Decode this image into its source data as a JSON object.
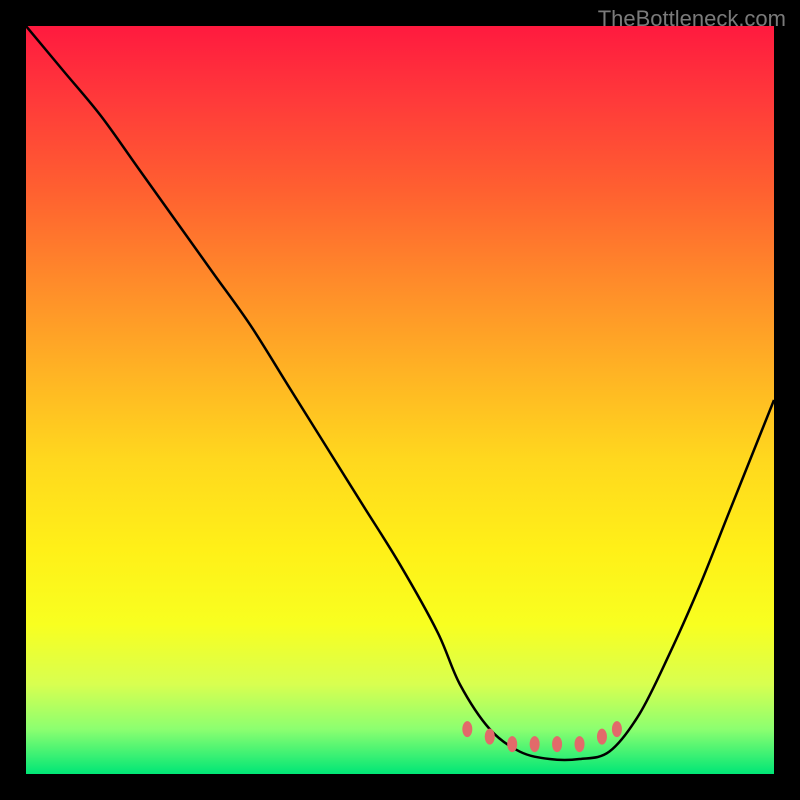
{
  "watermark": "TheBottleneck.com",
  "chart_data": {
    "type": "line",
    "title": "",
    "xlabel": "",
    "ylabel": "",
    "xlim": [
      0,
      100
    ],
    "ylim": [
      0,
      100
    ],
    "grid": false,
    "background_gradient": {
      "direction": "vertical",
      "stops": [
        {
          "pos": 0.0,
          "color": "#ff1a3f"
        },
        {
          "pos": 0.1,
          "color": "#ff3a3a"
        },
        {
          "pos": 0.22,
          "color": "#ff6030"
        },
        {
          "pos": 0.34,
          "color": "#ff8a2a"
        },
        {
          "pos": 0.46,
          "color": "#ffb224"
        },
        {
          "pos": 0.58,
          "color": "#ffd81e"
        },
        {
          "pos": 0.7,
          "color": "#fff018"
        },
        {
          "pos": 0.8,
          "color": "#f8ff20"
        },
        {
          "pos": 0.88,
          "color": "#d8ff50"
        },
        {
          "pos": 0.94,
          "color": "#8cff70"
        },
        {
          "pos": 1.0,
          "color": "#00e676"
        }
      ]
    },
    "series": [
      {
        "name": "bottleneck-curve",
        "color": "#000000",
        "x": [
          0,
          5,
          10,
          15,
          20,
          25,
          30,
          35,
          40,
          45,
          50,
          55,
          58,
          62,
          66,
          70,
          74,
          78,
          82,
          86,
          90,
          94,
          98,
          100
        ],
        "y": [
          100,
          94,
          88,
          81,
          74,
          67,
          60,
          52,
          44,
          36,
          28,
          19,
          12,
          6,
          3,
          2,
          2,
          3,
          8,
          16,
          25,
          35,
          45,
          50
        ]
      }
    ],
    "markers": [
      {
        "x": 59,
        "y": 6,
        "color": "#e26a6a"
      },
      {
        "x": 62,
        "y": 5,
        "color": "#e26a6a"
      },
      {
        "x": 65,
        "y": 4,
        "color": "#e26a6a"
      },
      {
        "x": 68,
        "y": 4,
        "color": "#e26a6a"
      },
      {
        "x": 71,
        "y": 4,
        "color": "#e26a6a"
      },
      {
        "x": 74,
        "y": 4,
        "color": "#e26a6a"
      },
      {
        "x": 77,
        "y": 5,
        "color": "#e26a6a"
      },
      {
        "x": 79,
        "y": 6,
        "color": "#e26a6a"
      }
    ]
  }
}
